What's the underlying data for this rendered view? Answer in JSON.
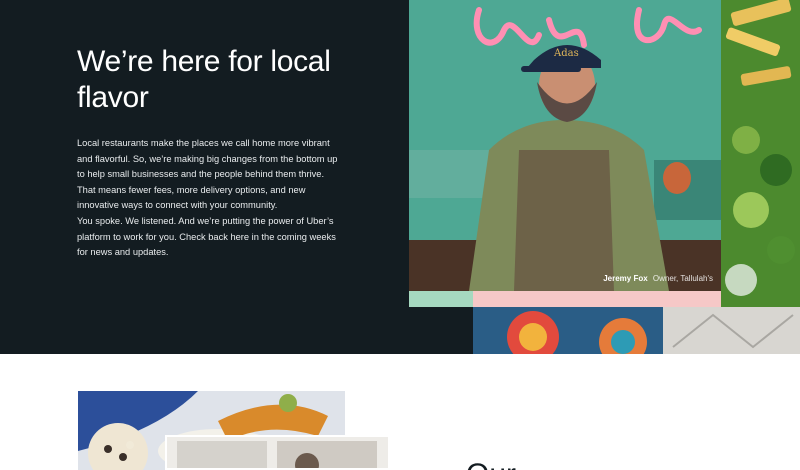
{
  "hero": {
    "title": "We’re here for local flavor",
    "paragraphs": [
      "Local restaurants make the places we call home more vibrant and flavorful. So, we’re making big changes from the bottom up to help small businesses and the people behind them thrive. That means fewer fees, more delivery options, and new innovative ways to connect with your community.",
      "You spoke. We listened. And we’re putting the power of Uber’s platform to work for you. Check back here in the coming weeks for news and updates."
    ],
    "photo_caption": {
      "name": "Jeremy Fox",
      "role": "Owner, Tallulah's"
    }
  },
  "lower": {
    "heading": "Our … "
  },
  "colors": {
    "hero_bg": "#131c21",
    "mint": "#a6d9c0",
    "pink": "#f6c8c7"
  }
}
